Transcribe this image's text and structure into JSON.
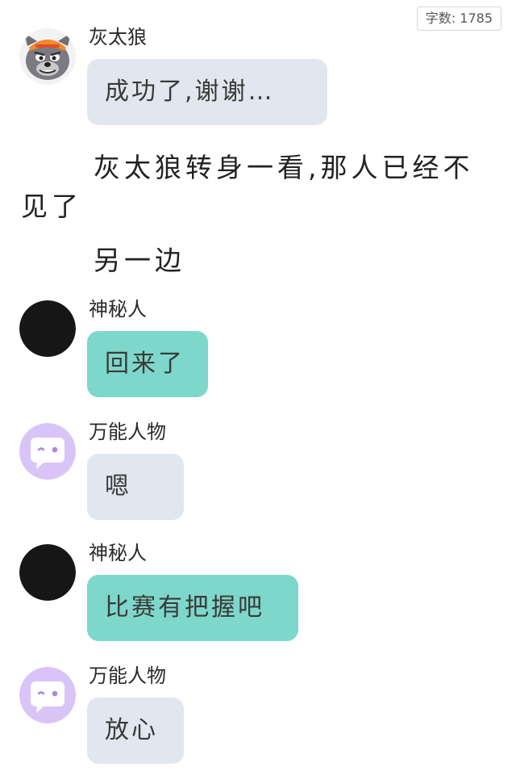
{
  "word_count": {
    "label": "字数:",
    "value": "1785"
  },
  "messages": [
    {
      "sender": "灰太狼",
      "text": "成功了,谢谢…",
      "avatar": "wolf-avatar-icon",
      "bubble_color": "#e2e6ee"
    },
    {
      "sender": "神秘人",
      "text": "回来了",
      "avatar": "black-circle-avatar-icon",
      "bubble_color": "#7ed7cb"
    },
    {
      "sender": "万能人物",
      "text": "嗯",
      "avatar": "purple-chat-avatar-icon",
      "bubble_color": "#e2e6ee"
    },
    {
      "sender": "神秘人",
      "text": "比赛有把握吧",
      "avatar": "black-circle-avatar-icon",
      "bubble_color": "#7ed7cb"
    },
    {
      "sender": "万能人物",
      "text": "放心",
      "avatar": "purple-chat-avatar-icon",
      "bubble_color": "#e2e6ee"
    }
  ],
  "narration": [
    "灰太狼转身一看,那人已经不",
    "见了",
    "另一边"
  ]
}
